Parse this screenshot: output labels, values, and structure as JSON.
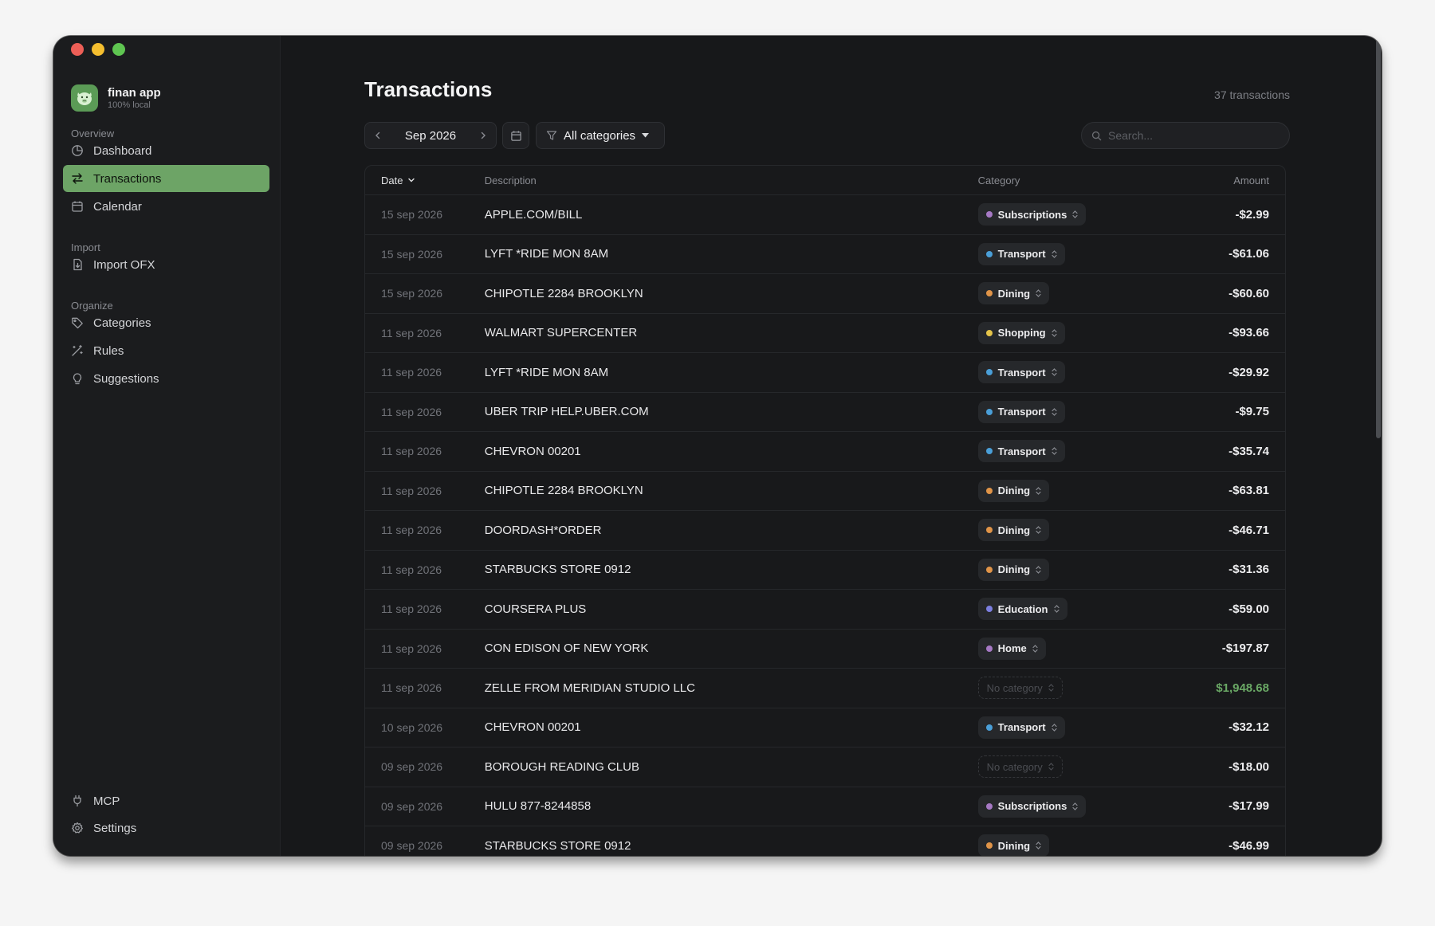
{
  "app": {
    "name": "finan app",
    "subtitle": "100% local"
  },
  "sidebar": {
    "sections": {
      "overview": "Overview",
      "import": "Import",
      "organize": "Organize"
    },
    "items": {
      "dashboard": "Dashboard",
      "transactions": "Transactions",
      "calendar": "Calendar",
      "import_ofx": "Import OFX",
      "categories": "Categories",
      "rules": "Rules",
      "suggestions": "Suggestions",
      "mcp": "MCP",
      "settings": "Settings"
    },
    "active": "transactions"
  },
  "main": {
    "title": "Transactions",
    "count": "37 transactions",
    "month": "Sep 2026",
    "category_filter": "All categories",
    "search_placeholder": "Search..."
  },
  "table": {
    "headers": {
      "date": "Date",
      "description": "Description",
      "category": "Category",
      "amount": "Amount"
    },
    "rows": [
      {
        "date": "15 sep 2026",
        "description": "APPLE.COM/BILL",
        "category": "Subscriptions",
        "color": "#a679c4",
        "amount": "-$2.99",
        "positive": false
      },
      {
        "date": "15 sep 2026",
        "description": "LYFT *RIDE MON 8AM",
        "category": "Transport",
        "color": "#4a9fd8",
        "amount": "-$61.06",
        "positive": false
      },
      {
        "date": "15 sep 2026",
        "description": "CHIPOTLE 2284 BROOKLYN",
        "category": "Dining",
        "color": "#e09448",
        "amount": "-$60.60",
        "positive": false
      },
      {
        "date": "11 sep 2026",
        "description": "WALMART SUPERCENTER",
        "category": "Shopping",
        "color": "#e5c44a",
        "amount": "-$93.66",
        "positive": false
      },
      {
        "date": "11 sep 2026",
        "description": "LYFT *RIDE MON 8AM",
        "category": "Transport",
        "color": "#4a9fd8",
        "amount": "-$29.92",
        "positive": false
      },
      {
        "date": "11 sep 2026",
        "description": "UBER TRIP HELP.UBER.COM",
        "category": "Transport",
        "color": "#4a9fd8",
        "amount": "-$9.75",
        "positive": false
      },
      {
        "date": "11 sep 2026",
        "description": "CHEVRON 00201",
        "category": "Transport",
        "color": "#4a9fd8",
        "amount": "-$35.74",
        "positive": false
      },
      {
        "date": "11 sep 2026",
        "description": "CHIPOTLE 2284 BROOKLYN",
        "category": "Dining",
        "color": "#e09448",
        "amount": "-$63.81",
        "positive": false
      },
      {
        "date": "11 sep 2026",
        "description": "DOORDASH*ORDER",
        "category": "Dining",
        "color": "#e09448",
        "amount": "-$46.71",
        "positive": false
      },
      {
        "date": "11 sep 2026",
        "description": "STARBUCKS STORE 0912",
        "category": "Dining",
        "color": "#e09448",
        "amount": "-$31.36",
        "positive": false
      },
      {
        "date": "11 sep 2026",
        "description": "COURSERA PLUS",
        "category": "Education",
        "color": "#7c7fe0",
        "amount": "-$59.00",
        "positive": false
      },
      {
        "date": "11 sep 2026",
        "description": "CON EDISON OF NEW YORK",
        "category": "Home",
        "color": "#a679c4",
        "amount": "-$197.87",
        "positive": false
      },
      {
        "date": "11 sep 2026",
        "description": "ZELLE FROM MERIDIAN STUDIO LLC",
        "category": "No category",
        "color": "",
        "amount": "$1,948.68",
        "positive": true
      },
      {
        "date": "10 sep 2026",
        "description": "CHEVRON 00201",
        "category": "Transport",
        "color": "#4a9fd8",
        "amount": "-$32.12",
        "positive": false
      },
      {
        "date": "09 sep 2026",
        "description": "BOROUGH READING CLUB",
        "category": "No category",
        "color": "",
        "amount": "-$18.00",
        "positive": false
      },
      {
        "date": "09 sep 2026",
        "description": "HULU 877-8244858",
        "category": "Subscriptions",
        "color": "#a679c4",
        "amount": "-$17.99",
        "positive": false
      },
      {
        "date": "09 sep 2026",
        "description": "STARBUCKS STORE 0912",
        "category": "Dining",
        "color": "#e09448",
        "amount": "-$46.99",
        "positive": false
      }
    ]
  }
}
